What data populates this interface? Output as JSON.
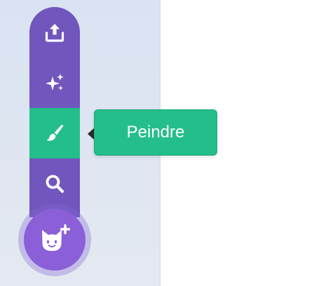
{
  "menu": {
    "items": [
      {
        "name": "upload",
        "icon": "upload-icon"
      },
      {
        "name": "surprise",
        "icon": "sparkles-icon"
      },
      {
        "name": "paint",
        "icon": "paintbrush-icon",
        "active": true
      },
      {
        "name": "search",
        "icon": "search-icon"
      }
    ],
    "fab_icon": "cat-add-icon"
  },
  "tooltip": {
    "label": "Peindre"
  },
  "colors": {
    "menu_purple": "#7156bd",
    "active_green": "#23be8b",
    "fab_purple": "#8a5fd8"
  }
}
